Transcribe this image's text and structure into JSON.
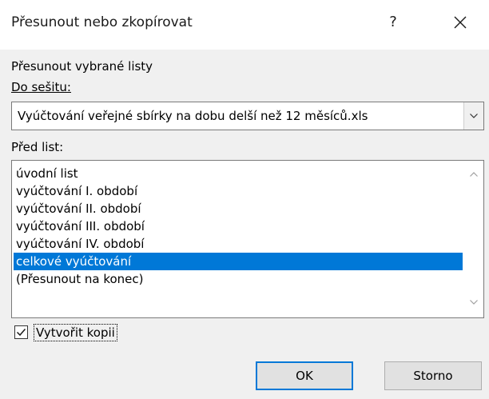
{
  "window": {
    "title": "Přesunout nebo zkopírovat",
    "help_label": "?",
    "icons": {
      "close": "close-icon"
    }
  },
  "form": {
    "move_heading": "Přesunout vybrané listy",
    "workbook_label": "Do sešitu:",
    "workbook_value": "Vyúčtování veřejné sbírky na dobu delší než 12 měsíců.xls",
    "before_sheet_label": "Před list:",
    "sheets": [
      "úvodní list",
      "vyúčtování I. období",
      "vyúčtování II. období",
      "vyúčtování III. období",
      "vyúčtování IV. období",
      "celkové vyúčtování",
      "(Přesunout na konec)"
    ],
    "selected_sheet_index": 5,
    "create_copy_label": "Vytvořit kopii",
    "create_copy_checked": true
  },
  "buttons": {
    "ok_label": "OK",
    "cancel_label": "Storno"
  },
  "colors": {
    "selection": "#0078d7",
    "default_button_border": "#0078d7"
  }
}
